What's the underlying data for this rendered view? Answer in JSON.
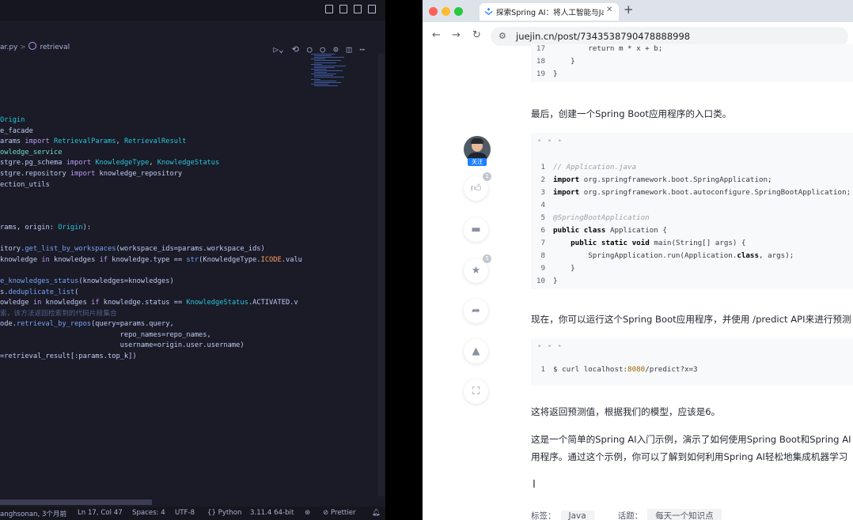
{
  "editor": {
    "breadcrumb": {
      "file": "ar.py",
      "symbol": "retrieval"
    },
    "code_lines": [
      [
        [
          "Origin",
          "cls"
        ]
      ],
      [
        [
          "e_facade",
          "var"
        ]
      ],
      [
        [
          "arams ",
          "var"
        ],
        [
          "import ",
          "kw"
        ],
        [
          "RetrievalParams",
          "cls"
        ],
        [
          ", ",
          "var"
        ],
        [
          "RetrievalResult",
          "cls"
        ]
      ],
      [
        [
          "owledge_service",
          "mod"
        ]
      ],
      [
        [
          "stgre.pg_schema ",
          "var"
        ],
        [
          "import ",
          "kw"
        ],
        [
          "KnowledgeType",
          "cls"
        ],
        [
          ", ",
          "var"
        ],
        [
          "KnowledgeStatus",
          "cls"
        ]
      ],
      [
        [
          "stgre.repository ",
          "var"
        ],
        [
          "import ",
          "kw"
        ],
        [
          "knowledge_repository",
          "var"
        ]
      ],
      [
        [
          "ection_utils",
          "var"
        ]
      ],
      [
        [
          "",
          "var"
        ]
      ],
      [
        [
          "",
          "var"
        ]
      ],
      [
        [
          "",
          "var"
        ]
      ],
      [
        [
          "rams, origin: ",
          "var"
        ],
        [
          "Origin",
          "cls"
        ],
        [
          "):",
          "var"
        ]
      ],
      [
        [
          "",
          "var"
        ]
      ],
      [
        [
          "itory.",
          "var"
        ],
        [
          "get_list_by_workspaces",
          "fn"
        ],
        [
          "(workspace_ids=params.workspace_ids)",
          "var"
        ]
      ],
      [
        [
          "knowledge ",
          "var"
        ],
        [
          "in ",
          "kw"
        ],
        [
          "knowledges ",
          "var"
        ],
        [
          "if ",
          "kw"
        ],
        [
          "knowledge.type == ",
          "var"
        ],
        [
          "str",
          "fn"
        ],
        [
          "(KnowledgeType.",
          "var"
        ],
        [
          "ICODE",
          "en"
        ],
        [
          ".valu",
          "var"
        ]
      ],
      [
        [
          "",
          "var"
        ]
      ],
      [
        [
          "e_knowledges_status",
          "fn"
        ],
        [
          "(knowledges=knowledges)",
          "var"
        ]
      ],
      [
        [
          "s.",
          "var"
        ],
        [
          "deduplicate_list",
          "fn"
        ],
        [
          "(",
          "var"
        ]
      ],
      [
        [
          "owledge ",
          "var"
        ],
        [
          "in ",
          "kw"
        ],
        [
          "knowledges ",
          "var"
        ],
        [
          "if ",
          "kw"
        ],
        [
          "knowledge.status == ",
          "var"
        ],
        [
          "KnowledgeStatus",
          "cls"
        ],
        [
          ".ACTIVATED.v",
          "var"
        ]
      ],
      [
        [
          "索，该方法返回检索到的代码片段集合",
          "cm"
        ]
      ],
      [
        [
          "ode.",
          "var"
        ],
        [
          "retrieval_by_repos",
          "fn"
        ],
        [
          "(query=params.query,",
          "var"
        ]
      ],
      [
        [
          "                             repo_names=repo_names,",
          "var"
        ]
      ],
      [
        [
          "                             username=origin.user.username)",
          "var"
        ]
      ],
      [
        [
          "=retrieval_result[:params.top_k])",
          "var"
        ]
      ]
    ],
    "status": {
      "blame": "anghsonan, 3个月前",
      "position": "Ln 17, Col 47",
      "spaces": "Spaces: 4",
      "encoding": "UTF-8",
      "language": "Python",
      "interpreter": "3.11.4 64-bit",
      "formatter": "Prettier"
    }
  },
  "browser": {
    "tab_title": "探索Spring AI：将人工智能与Ja",
    "url": "juejin.cn/post/7343538790478888998",
    "sidebar": {
      "follow_label": "关注",
      "like_count": "1",
      "favorite_count": "5"
    },
    "code_block_1": [
      {
        "no": "18",
        "text": "    }"
      },
      {
        "no": "19",
        "text": "}"
      }
    ],
    "para_1": "最后，创建一个Spring Boot应用程序的入口类。",
    "code_block_2": [
      {
        "no": "1",
        "text": "// Application.java"
      },
      {
        "no": "2",
        "text": "import org.springframework.boot.SpringApplication;"
      },
      {
        "no": "3",
        "text": "import org.springframework.boot.autoconfigure.SpringBootApplication;"
      },
      {
        "no": "4",
        "text": ""
      },
      {
        "no": "5",
        "text": "@SpringBootApplication"
      },
      {
        "no": "6",
        "text": "public class Application {"
      },
      {
        "no": "7",
        "text": "    public static void main(String[] args) {"
      },
      {
        "no": "8",
        "text": "        SpringApplication.run(Application.class, args);"
      },
      {
        "no": "9",
        "text": "    }"
      },
      {
        "no": "10",
        "text": "}"
      }
    ],
    "para_2": "现在，你可以运行这个Spring Boot应用程序，并使用 /predict API来进行预测",
    "code_block_3": [
      {
        "no": "1",
        "text": "$ curl localhost:8080/predict?x=3"
      }
    ],
    "para_3": "这将返回预测值，根据我们的模型，应该是6。",
    "para_4a": "这是一个简单的Spring AI入门示例，演示了如何使用Spring Boot和Spring AI",
    "para_4b": "用程序。通过这个示例，你可以了解到如何利用Spring AI轻松地集成机器学习",
    "tags": {
      "label": "标签：",
      "tag": "Java",
      "topic_label": "话题：",
      "topic": "每天一个知识点"
    }
  }
}
